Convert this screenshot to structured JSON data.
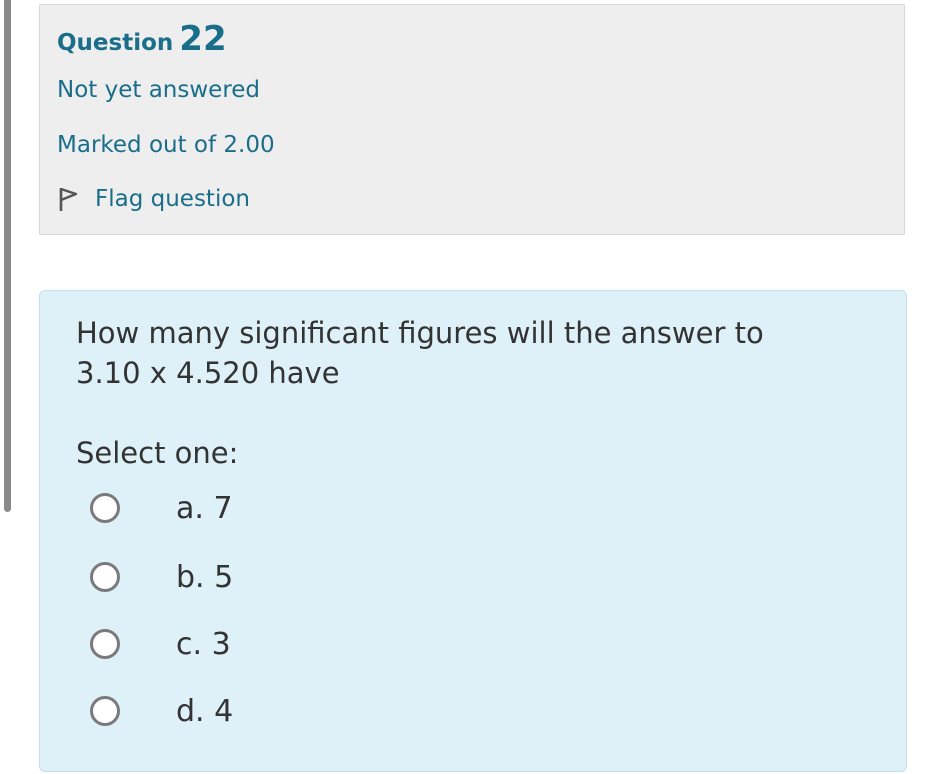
{
  "question": {
    "label": "Question",
    "number": "22",
    "state": "Not yet answered",
    "grade": "Marked out of 2.00",
    "flag_label": "Flag question",
    "flag_icon": "flag-icon"
  },
  "content": {
    "text": "How many significant figures will the answer to 3.10 x 4.520 have",
    "prompt": "Select one:",
    "options": [
      {
        "label": "a. 7"
      },
      {
        "label": "b. 5"
      },
      {
        "label": "c. 3"
      },
      {
        "label": "d. 4"
      }
    ]
  },
  "colors": {
    "accent": "#1a6e8a",
    "info_bg": "#eeeeee",
    "content_bg": "#def0f8"
  }
}
